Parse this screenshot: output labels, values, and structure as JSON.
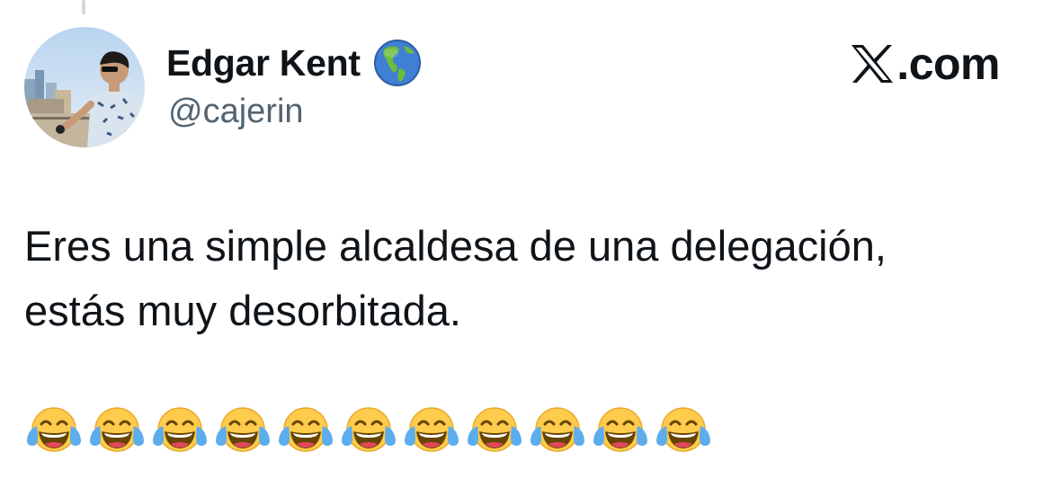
{
  "author": {
    "display_name": "Edgar Kent",
    "handle": "@cajerin",
    "badge_icon": "globe-americas-icon",
    "avatar": "user-photo-avatar"
  },
  "brand": {
    "logo_icon": "x-logo-icon",
    "text": ".com"
  },
  "tweet": {
    "lines": [
      "Eres una simple alcaldesa de una delegación,",
      "estás muy desorbitada."
    ],
    "emoji_icon": "face-with-tears-of-joy-icon",
    "emoji_count": 11
  },
  "colors": {
    "text": "#0f1419",
    "secondary_text": "#536471",
    "thread_line": "#cfd9de",
    "emoji_face": "#FFCB4C"
  }
}
